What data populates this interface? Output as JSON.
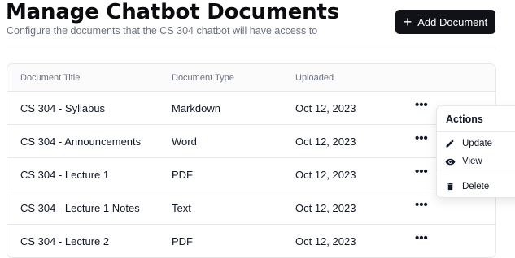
{
  "header": {
    "title": "Manage Chatbot Documents",
    "subtitle": "Configure the documents that the CS 304 chatbot will have access to",
    "add_button_label": "Add Document"
  },
  "table": {
    "columns": [
      "Document Title",
      "Document Type",
      "Uploaded"
    ],
    "rows": [
      {
        "title": "CS 304 - Syllabus",
        "type": "Markdown",
        "uploaded": "Oct 12, 2023"
      },
      {
        "title": "CS 304 - Announcements",
        "type": "Word",
        "uploaded": "Oct 12, 2023"
      },
      {
        "title": "CS 304 - Lecture 1",
        "type": "PDF",
        "uploaded": "Oct 12, 2023"
      },
      {
        "title": "CS 304 - Lecture 1 Notes",
        "type": "Text",
        "uploaded": "Oct 12, 2023"
      },
      {
        "title": "CS 304 - Lecture 2",
        "type": "PDF",
        "uploaded": "Oct 12, 2023"
      }
    ],
    "row_action_icon": "more-horizontal-icon"
  },
  "actions_menu": {
    "title": "Actions",
    "items": [
      {
        "label": "Update",
        "icon": "pencil-icon"
      },
      {
        "label": "View",
        "icon": "eye-icon"
      },
      {
        "label": "Delete",
        "icon": "trash-icon"
      }
    ]
  },
  "colors": {
    "primary_button": "#111217",
    "border": "#e5e7eb",
    "muted_text": "#6b7280"
  }
}
